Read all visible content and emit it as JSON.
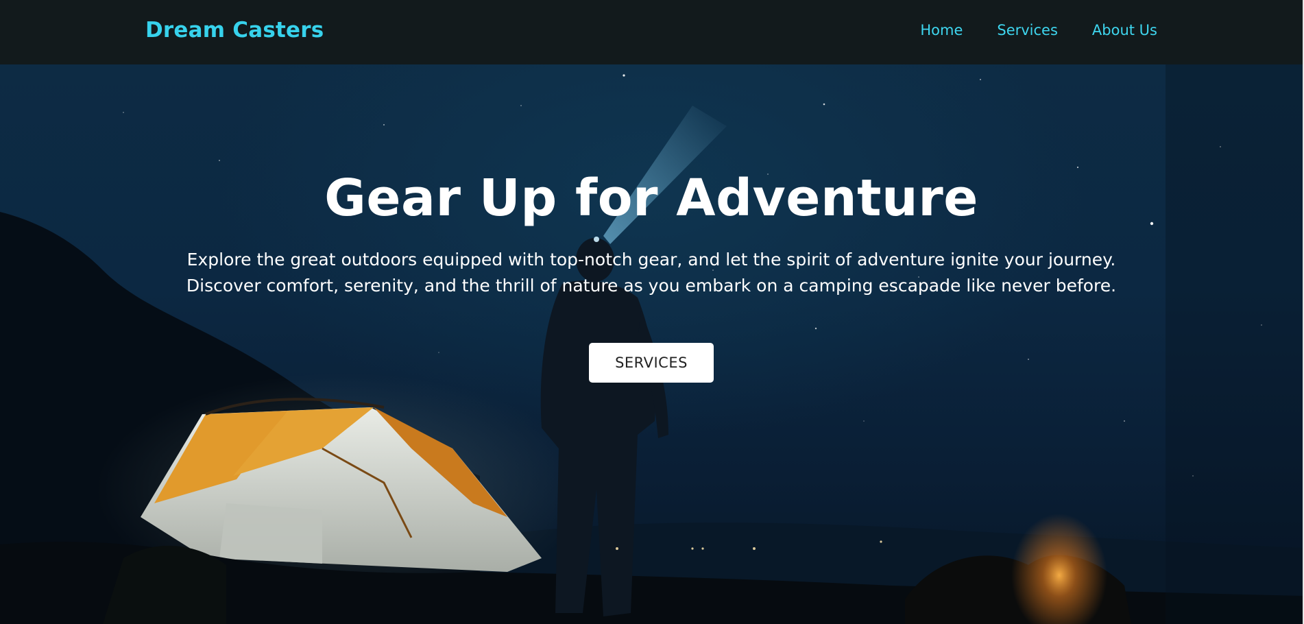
{
  "navbar": {
    "brand": "Dream Casters",
    "links": [
      {
        "label": "Home"
      },
      {
        "label": "Services"
      },
      {
        "label": "About Us"
      }
    ]
  },
  "hero": {
    "title": "Gear Up for Adventure",
    "description_line1": "Explore the great outdoors equipped with top-notch gear, and let the spirit of adventure ignite your journey.",
    "description_line2": "Discover comfort, serenity, and the thrill of nature as you embark on a camping escapade like never before.",
    "cta_label": "SERVICES"
  },
  "colors": {
    "navbar_bg": "#121a1c",
    "accent": "#37d2ec",
    "hero_text": "#ffffff",
    "button_bg": "#ffffff"
  }
}
